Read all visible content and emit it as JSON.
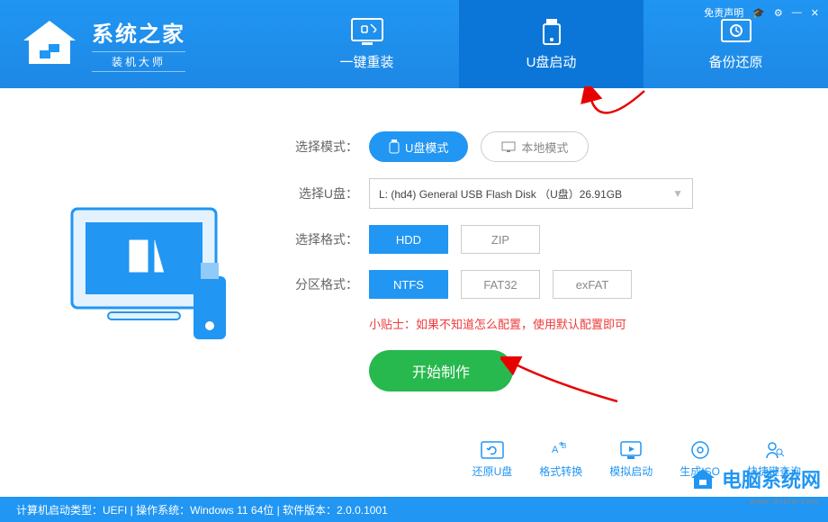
{
  "titlebar": {
    "disclaimer": "免责声明"
  },
  "logo": {
    "title": "系统之家",
    "subtitle": "装机大师"
  },
  "tabs": [
    {
      "label": "一键重装",
      "active": false
    },
    {
      "label": "U盘启动",
      "active": true
    },
    {
      "label": "备份还原",
      "active": false
    }
  ],
  "mode": {
    "label": "选择模式：",
    "usb": "U盘模式",
    "local": "本地模式"
  },
  "udisk": {
    "label": "选择U盘：",
    "value": "L: (hd4) General USB Flash Disk （U盘）26.91GB"
  },
  "format": {
    "label": "选择格式：",
    "opts": [
      "HDD",
      "ZIP"
    ],
    "sel": 0
  },
  "partition": {
    "label": "分区格式：",
    "opts": [
      "NTFS",
      "FAT32",
      "exFAT"
    ],
    "sel": 0
  },
  "tip": "小贴士：如果不知道怎么配置，使用默认配置即可",
  "start": "开始制作",
  "tools": [
    {
      "label": "还原U盘"
    },
    {
      "label": "格式转换"
    },
    {
      "label": "模拟启动"
    },
    {
      "label": "生成ISO"
    },
    {
      "label": "快捷键查询"
    }
  ],
  "status": "计算机启动类型：UEFI  |  操作系统：Windows 11 64位  |  软件版本：2.0.0.1001",
  "watermark": {
    "text": "电脑系统网",
    "url": "www.dnxtw.com"
  }
}
